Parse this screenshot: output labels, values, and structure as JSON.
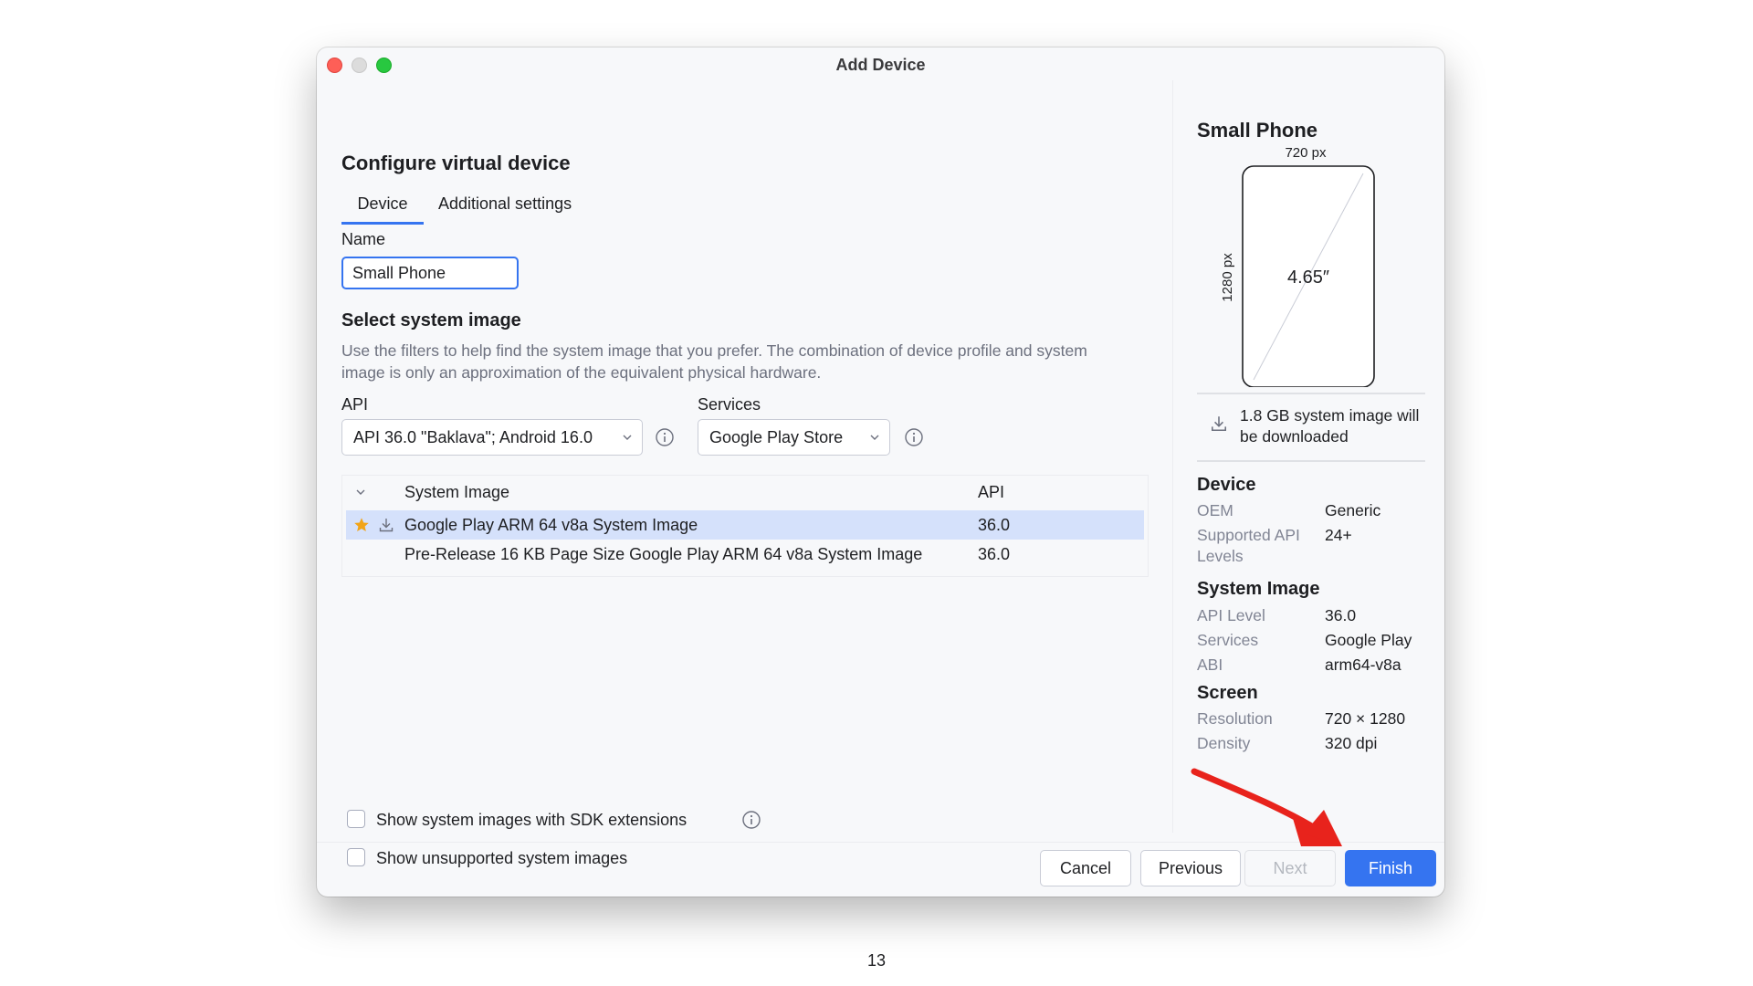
{
  "window": {
    "title": "Add Device"
  },
  "main": {
    "heading": "Configure virtual device",
    "tabs": [
      {
        "label": "Device",
        "active": true
      },
      {
        "label": "Additional settings",
        "active": false
      }
    ],
    "name_label": "Name",
    "name_value": "Small Phone",
    "section_title": "Select system image",
    "description": "Use the filters to help find the system image that you prefer. The combination of device profile and system image is only an approximation of the equivalent physical hardware.",
    "api_label": "API",
    "api_value": "API 36.0 \"Baklava\"; Android 16.0",
    "services_label": "Services",
    "services_value": "Google Play Store",
    "table": {
      "columns": [
        "System Image",
        "API"
      ],
      "rows": [
        {
          "name": "Google Play ARM 64 v8a System Image",
          "api": "36.0",
          "selected": true,
          "starred": true,
          "downloadable": true
        },
        {
          "name": "Pre-Release 16 KB Page Size Google Play ARM 64 v8a System Image",
          "api": "36.0",
          "selected": false,
          "starred": false,
          "downloadable": false
        }
      ]
    },
    "checkboxes": [
      {
        "label": "Show system images with SDK extensions",
        "checked": false
      },
      {
        "label": "Show unsupported system images",
        "checked": false
      }
    ]
  },
  "sidebar": {
    "title": "Small Phone",
    "preview": {
      "width_label": "720 px",
      "height_label": "1280 px",
      "diagonal": "4.65″"
    },
    "download_note": "1.8 GB system image will be downloaded",
    "device": {
      "title": "Device",
      "oem_label": "OEM",
      "oem_value": "Generic",
      "api_levels_label": "Supported API Levels",
      "api_levels_value": "24+"
    },
    "system_image": {
      "title": "System Image",
      "api_level_label": "API Level",
      "api_level_value": "36.0",
      "services_label": "Services",
      "services_value": "Google Play",
      "abi_label": "ABI",
      "abi_value": "arm64-v8a"
    },
    "screen": {
      "title": "Screen",
      "resolution_label": "Resolution",
      "resolution_value": "720 × 1280",
      "density_label": "Density",
      "density_value": "320 dpi"
    }
  },
  "footer": {
    "cancel": "Cancel",
    "previous": "Previous",
    "next": "Next",
    "finish": "Finish"
  },
  "colors": {
    "accent": "#3574f0",
    "selection": "#d5e1fb",
    "star": "#f2a418",
    "annotation_arrow": "#e8231c"
  },
  "page_number": "13"
}
